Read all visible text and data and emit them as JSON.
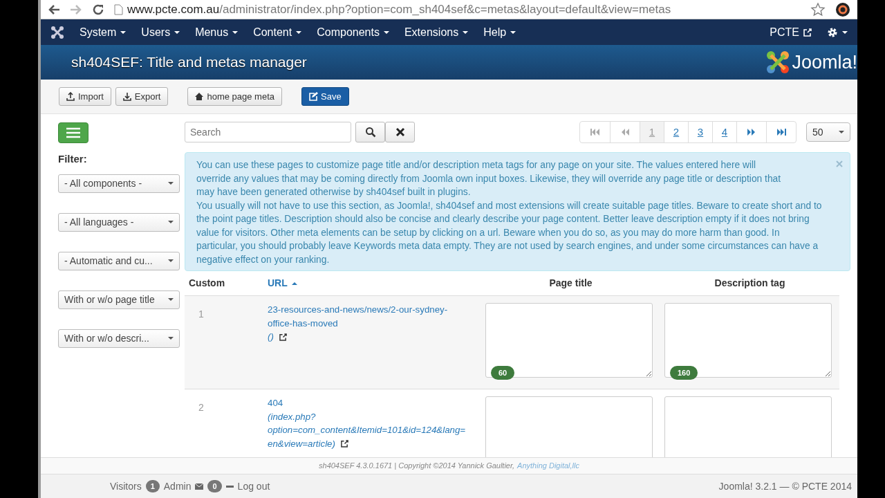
{
  "browser": {
    "url_host": "www.pcte.com.au",
    "url_path": "/administrator/index.php?option=com_sh404sef&c=metas&layout=default&view=metas"
  },
  "menu": [
    "System",
    "Users",
    "Menus",
    "Content",
    "Components",
    "Extensions",
    "Help"
  ],
  "site_link": "PCTE",
  "page_title": "sh404SEF: Title and metas manager",
  "brand": "Joomla!",
  "toolbar": [
    {
      "label": "Import",
      "kind": "import"
    },
    {
      "label": "Export",
      "kind": "export"
    },
    {
      "label": "home page meta",
      "kind": "home"
    },
    {
      "label": "Save",
      "kind": "save"
    }
  ],
  "filter_label": "Filter:",
  "filters": [
    "- All components -",
    "- All languages -",
    "- Automatic and cu...",
    "With or w/o page title",
    "With or w/o descri..."
  ],
  "search": {
    "placeholder": "Search"
  },
  "pagination": [
    {
      "kind": "first",
      "disabled": true
    },
    {
      "kind": "prev",
      "disabled": true
    },
    {
      "kind": "page",
      "label": "1",
      "selected": true
    },
    {
      "kind": "page",
      "label": "2",
      "selected": false
    },
    {
      "kind": "page",
      "label": "3",
      "selected": false
    },
    {
      "kind": "page",
      "label": "4",
      "selected": false
    },
    {
      "kind": "next",
      "disabled": false
    },
    {
      "kind": "last",
      "disabled": false
    }
  ],
  "page_size": "50",
  "notice": [
    "You can use these pages to customize page title and/or description meta tags for any page on your site. The values entered here will override any values that may be coming directly from Joomla own input boxes. Likewise, they will override any page title or description that may have been generated otherwise by sh404sef built in plugins.",
    "You usually will not have to use this section, as Joomla!, sh404sef and most extensions will create suitable page titles. Beware to create short and to the point page titles. Description should also be concise and clearly describe your page content. Better leave description empty if it does not bring value for visitors. Other meta elements can be setup by clicking on a url. Beware when you do so, as you may do more harm than good. In particular, you should probably leave Keywords meta data empty. They are not used by search engines, and under some circumstances can have a negative effect on your ranking."
  ],
  "table": {
    "columns": [
      {
        "label": "Custom",
        "link": false
      },
      {
        "label": "URL",
        "link": true,
        "sorted_ascending": true
      },
      {
        "label": "Page title",
        "link": false
      },
      {
        "label": "Description tag",
        "link": false
      }
    ],
    "rows": [
      {
        "number": "1",
        "url": "23-resources-and-news/news/2-our-sydney-office-has-moved",
        "target": "()",
        "title_count": "60",
        "desc_count": "160"
      },
      {
        "number": "2",
        "url": "404",
        "target": "(index.php?option=com_content&Itemid=101&id=124&lang=en&view=article)"
      }
    ]
  },
  "footer": {
    "text": "sh404SEF 4.3.0.1671 | Copyright ©2014 Yannick Gaultier,",
    "link": "Anything Digital,llc"
  },
  "status": {
    "visitors": "Visitors",
    "admin_count": "1",
    "admin": "Admin",
    "messages_count": "0",
    "logout": "Log out",
    "version": "Joomla! 3.2.1 — © PCTE 2014"
  }
}
